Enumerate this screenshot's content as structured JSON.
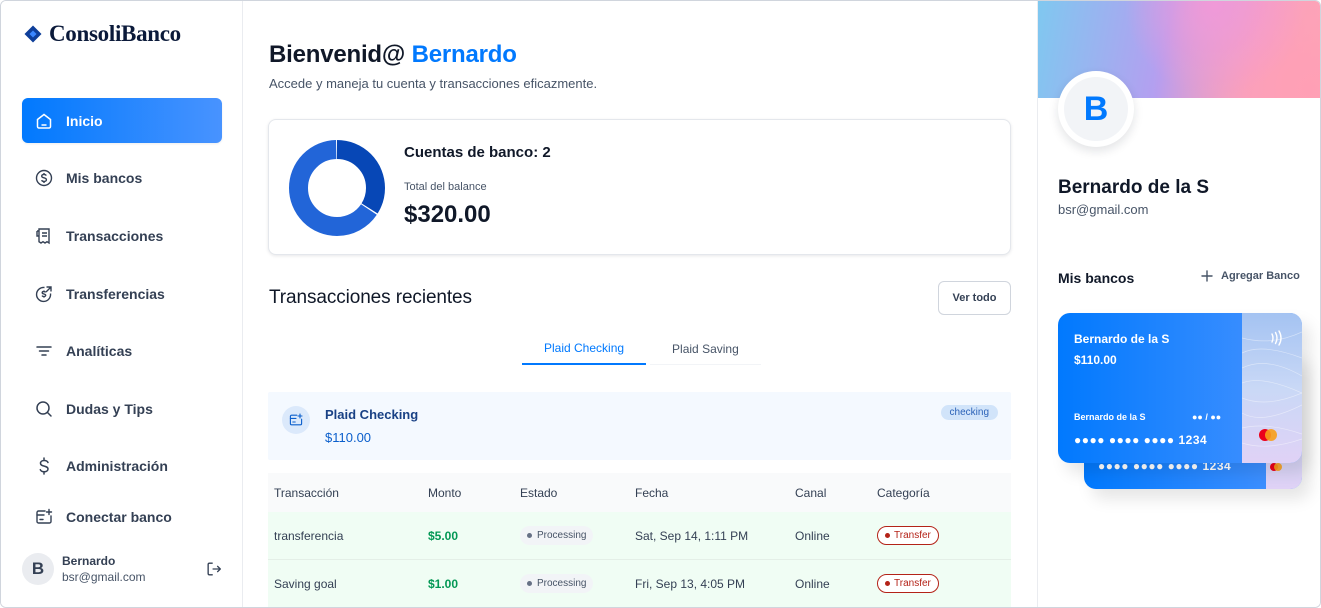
{
  "app": {
    "logo_text": "ConsoliBanco"
  },
  "sidebar": {
    "items": [
      {
        "label": "Inicio",
        "icon": "home-icon",
        "active": true
      },
      {
        "label": "Mis bancos",
        "icon": "dollar-circle-icon"
      },
      {
        "label": "Transacciones",
        "icon": "receipt-icon"
      },
      {
        "label": "Transferencias",
        "icon": "money-send-icon"
      },
      {
        "label": "Analíticas",
        "icon": "filter-lines-icon"
      },
      {
        "label": "Dudas y Tips",
        "icon": "search-icon"
      },
      {
        "label": "Administración",
        "icon": "dollar-sign-icon"
      },
      {
        "label": "Conectar banco",
        "icon": "connect-bank-icon"
      }
    ],
    "user": {
      "initial": "B",
      "name": "Bernardo",
      "email": "bsr@gmail.com",
      "logout_icon": "logout-icon"
    }
  },
  "header": {
    "greeting": "Bienvenid@",
    "name": "Bernardo",
    "subtitle": "Accede y maneja tu cuenta y transacciones eficazmente."
  },
  "balance": {
    "accounts_label": "Cuentas de banco: 2",
    "total_label": "Total del balance",
    "total_amount": "$320.00",
    "donut": [
      {
        "value": 110,
        "color": "#0747b6"
      },
      {
        "value": 210,
        "color": "#2265d8"
      }
    ]
  },
  "recent": {
    "title": "Transacciones recientes",
    "view_all": "Ver todo",
    "tabs": [
      {
        "label": "Plaid Checking",
        "active": true
      },
      {
        "label": "Plaid Saving",
        "active": false
      }
    ],
    "account": {
      "name": "Plaid Checking",
      "balance": "$110.00",
      "badge": "checking"
    },
    "columns": [
      "Transacción",
      "Monto",
      "Estado",
      "Fecha",
      "Canal",
      "Categoría"
    ],
    "rows": [
      {
        "name": "transferencia",
        "amount": "$5.00",
        "status": "Processing",
        "date": "Sat, Sep 14, 1:11 PM",
        "channel": "Online",
        "category": "Transfer"
      },
      {
        "name": "Saving goal",
        "amount": "$1.00",
        "status": "Processing",
        "date": "Fri, Sep 13, 4:05 PM",
        "channel": "Online",
        "category": "Transfer"
      }
    ]
  },
  "profile": {
    "initial": "B",
    "name": "Bernardo de la S",
    "email": "bsr@gmail.com",
    "my_banks": "Mis bancos",
    "add_bank": "Agregar Banco",
    "cards": [
      {
        "name": "Bernardo de la S",
        "amount": "$110.00",
        "holder": "Bernardo de la S",
        "expiry": "●● / ●●",
        "number": "●●●● ●●●● ●●●● 1234"
      },
      {
        "number": "●●●● ●●●● ●●●● 1234"
      }
    ],
    "colors": {
      "accent": "#0179fe",
      "status_success": "#039855",
      "category_transfer": "#b42318"
    }
  }
}
